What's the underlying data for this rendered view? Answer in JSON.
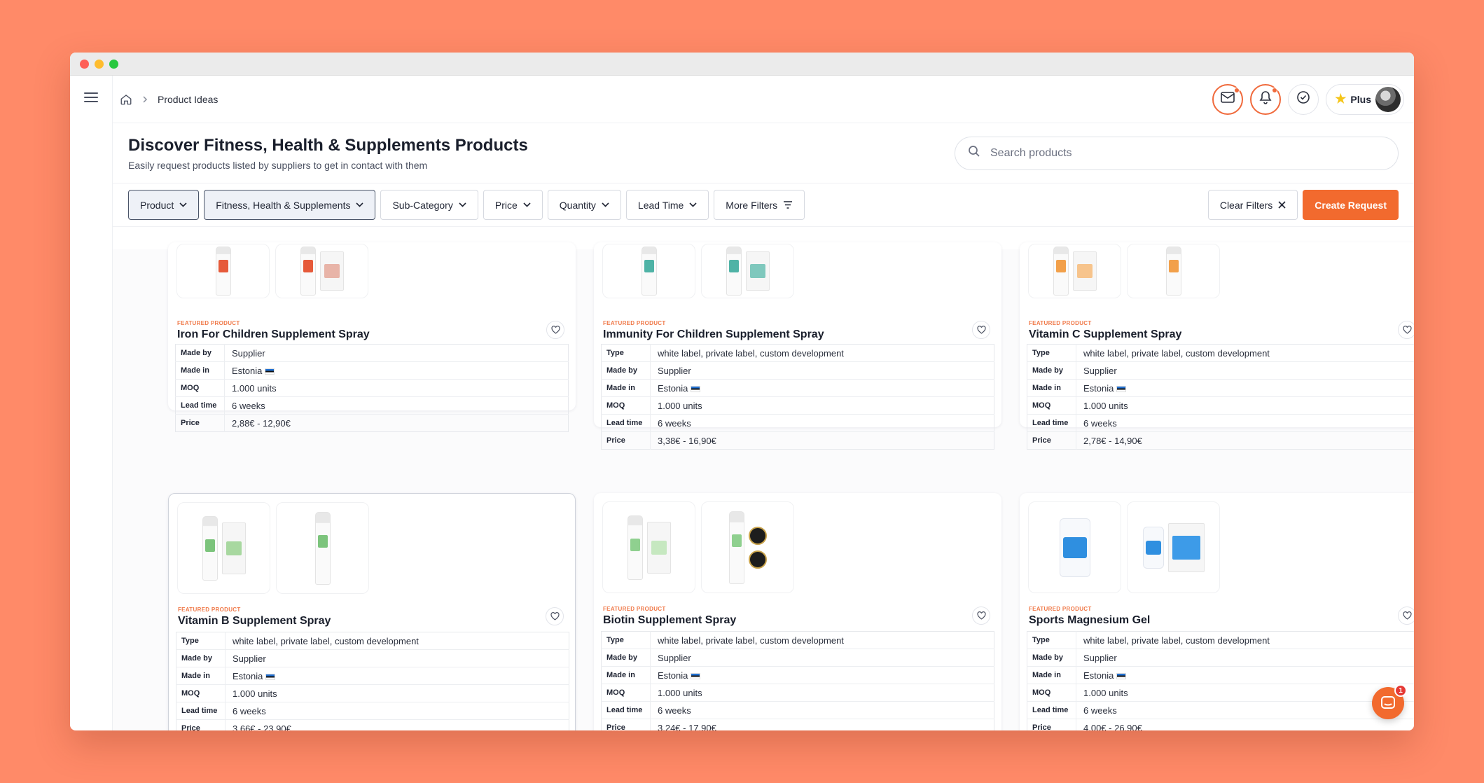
{
  "breadcrumb": {
    "current": "Product Ideas"
  },
  "topbar": {
    "plus_label": "Plus"
  },
  "header": {
    "title": "Discover Fitness, Health & Supplements Products",
    "subtitle": "Easily request products listed by suppliers to get in contact with them",
    "search_placeholder": "Search products"
  },
  "filters": {
    "product": "Product",
    "category": "Fitness, Health & Supplements",
    "subcategory": "Sub-Category",
    "price": "Price",
    "quantity": "Quantity",
    "lead_time": "Lead Time",
    "more_filters": "More Filters",
    "clear_filters": "Clear Filters",
    "create_request": "Create Request"
  },
  "featured_label": "FEATURED PRODUCT",
  "field_labels": {
    "type": "Type",
    "made_by": "Made by",
    "made_in": "Made in",
    "moq": "MOQ",
    "lead_time": "Lead time",
    "price": "Price"
  },
  "products": [
    {
      "name": "Iron For Children Supplement Spray",
      "type": null,
      "made_by": "Supplier",
      "made_in": "Estonia",
      "moq": "1.000 units",
      "lead_time": "6 weeks",
      "price": "2,88€ - 12,90€"
    },
    {
      "name": "Immunity For Children Supplement Spray",
      "type": "white label, private label, custom development",
      "made_by": "Supplier",
      "made_in": "Estonia",
      "moq": "1.000 units",
      "lead_time": "6 weeks",
      "price": "3,38€ - 16,90€"
    },
    {
      "name": "Vitamin C Supplement Spray",
      "type": "white label, private label, custom development",
      "made_by": "Supplier",
      "made_in": "Estonia",
      "moq": "1.000 units",
      "lead_time": "6 weeks",
      "price": "2,78€ - 14,90€"
    },
    {
      "name": "Vitamin B Supplement Spray",
      "type": "white label, private label, custom development",
      "made_by": "Supplier",
      "made_in": "Estonia",
      "moq": "1.000 units",
      "lead_time": "6 weeks",
      "price": "3,66€ - 23,90€"
    },
    {
      "name": "Biotin Supplement Spray",
      "type": "white label, private label, custom development",
      "made_by": "Supplier",
      "made_in": "Estonia",
      "moq": "1.000 units",
      "lead_time": "6 weeks",
      "price": "3,24€ - 17,90€"
    },
    {
      "name": "Sports Magnesium Gel",
      "type": "white label, private label, custom development",
      "made_by": "Supplier",
      "made_in": "Estonia",
      "moq": "1.000 units",
      "lead_time": "6 weeks",
      "price": "4,00€ - 26,90€"
    }
  ],
  "chat": {
    "unread_count": "1"
  },
  "colors": {
    "accent": "#f26a2e",
    "background": "#ff8a68"
  }
}
